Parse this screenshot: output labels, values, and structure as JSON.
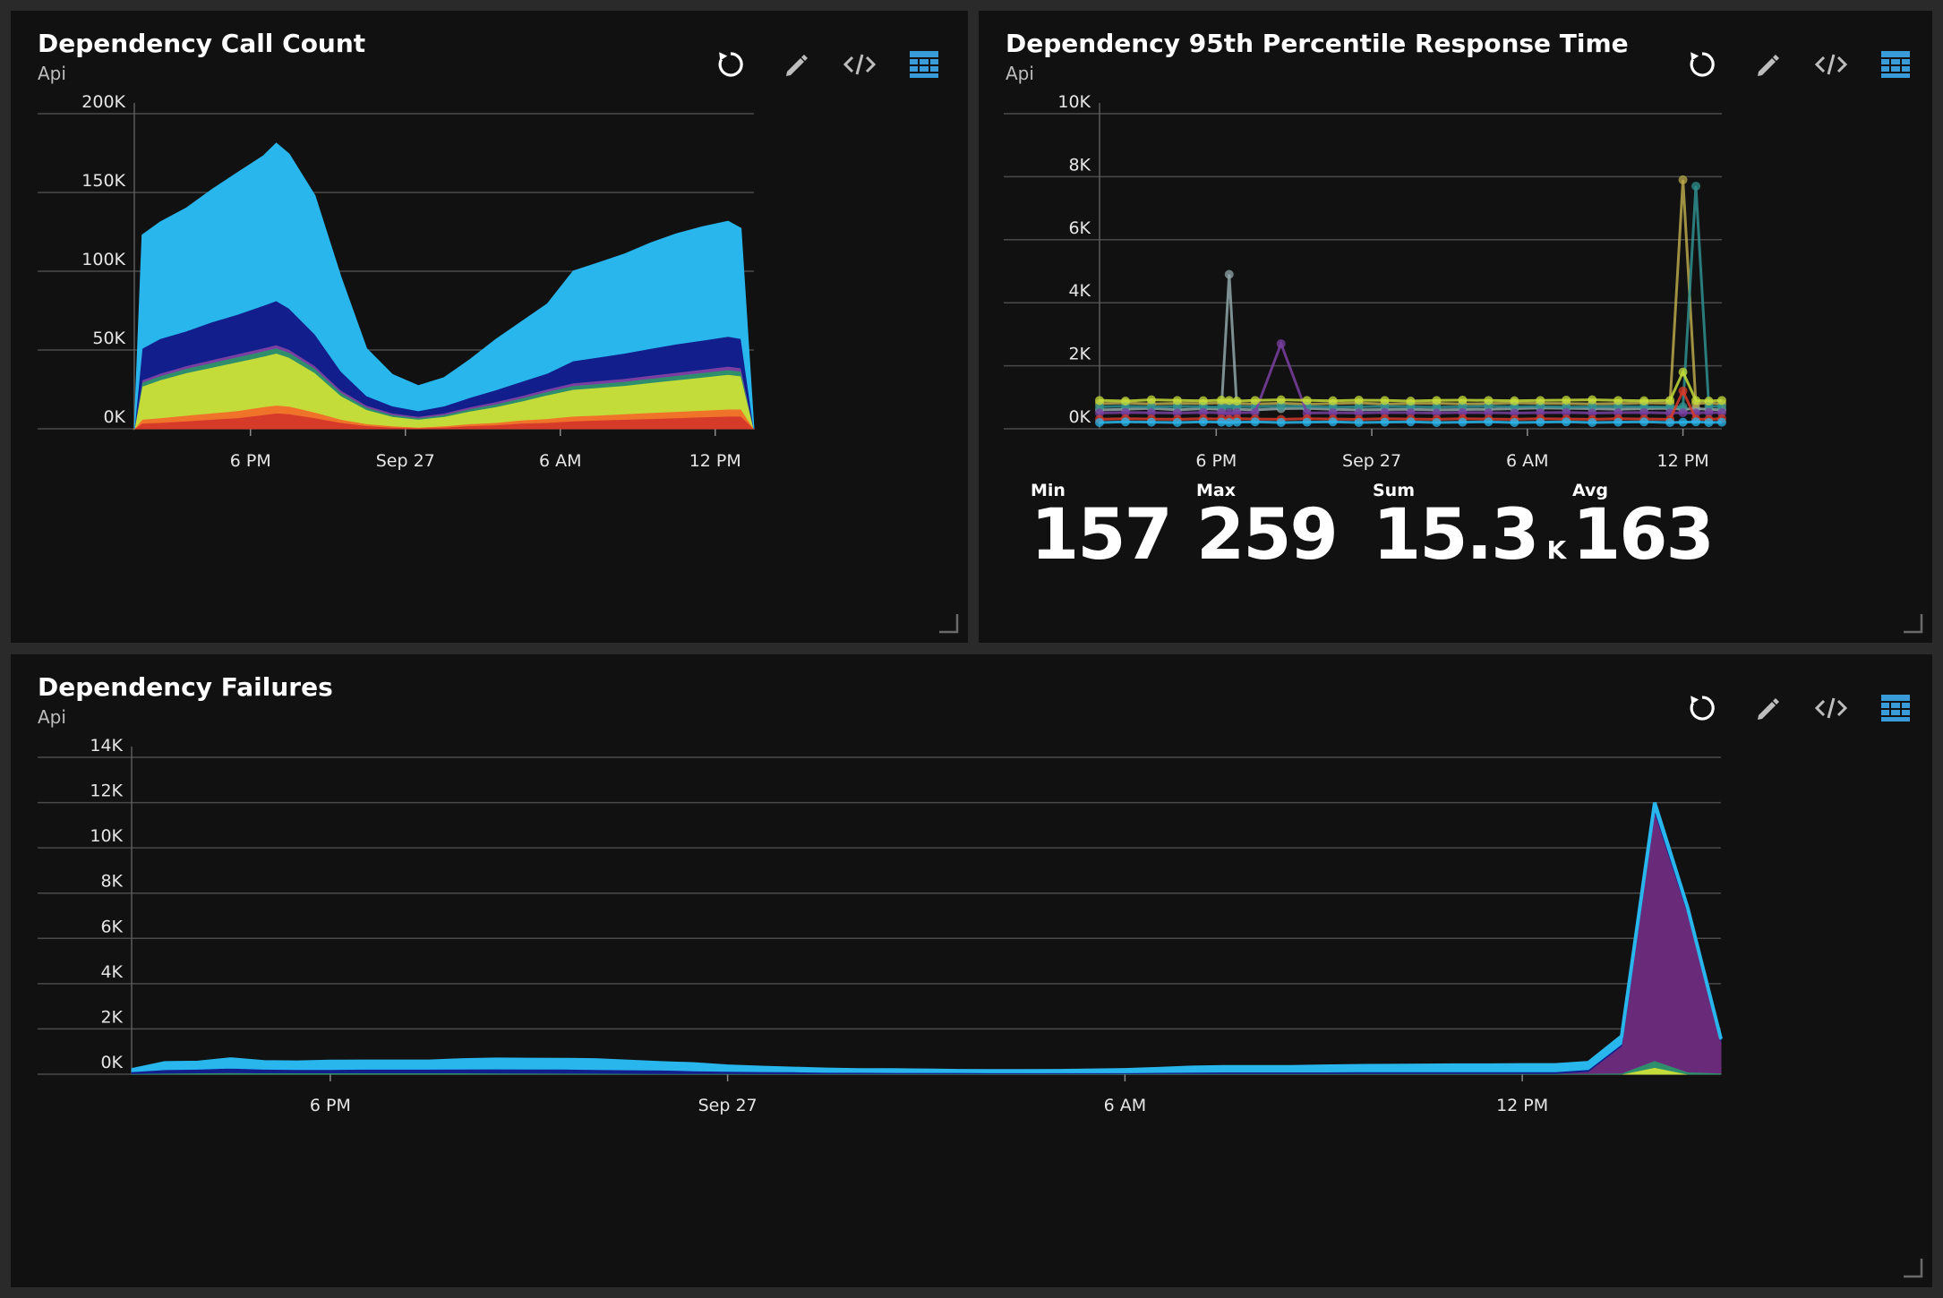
{
  "tiles": {
    "calls": {
      "title": "Dependency Call Count",
      "subtitle": "Api"
    },
    "response": {
      "title": "Dependency 95th Percentile Response Time",
      "subtitle": "Api",
      "stats": {
        "min_label": "Min",
        "min_value": "157",
        "max_label": "Max",
        "max_value": "259",
        "sum_label": "Sum",
        "sum_value": "15.3",
        "sum_unit": "K",
        "avg_label": "Avg",
        "avg_value": "163"
      }
    },
    "failures": {
      "title": "Dependency Failures",
      "subtitle": "Api"
    }
  },
  "icons": [
    "refresh-icon",
    "pencil-icon",
    "code-icon",
    "grid-icon"
  ],
  "colors": {
    "tile_bg": "#111111",
    "page_bg": "#2a2a2b",
    "grid": "#4a4a4a",
    "accent_blue": "#3a9bd9"
  },
  "chart_data": [
    {
      "id": "calls",
      "type": "area",
      "stacked": true,
      "xlim": [
        0,
        24
      ],
      "ylim": [
        0,
        200000
      ],
      "yticks": [
        0,
        50000,
        100000,
        150000,
        200000
      ],
      "ytick_labels": [
        "0K",
        "50K",
        "100K",
        "150K",
        "200K"
      ],
      "xticks": [
        4.5,
        10.5,
        16.5,
        22.5
      ],
      "xtick_labels": [
        "6 PM",
        "Sep 27",
        "6 AM",
        "12 PM"
      ],
      "x": [
        0,
        0.3,
        1,
        2,
        3,
        4,
        5,
        5.5,
        6,
        7,
        8,
        9,
        10,
        11,
        12,
        13,
        14,
        15,
        16,
        17,
        18,
        19,
        20,
        21,
        22,
        23,
        23.5,
        24
      ],
      "series": [
        {
          "color": "#d63b2a",
          "values": [
            0,
            3500,
            4000,
            5000,
            6000,
            7000,
            9000,
            10000,
            9500,
            7000,
            4000,
            2000,
            1000,
            500,
            1000,
            2000,
            2500,
            3500,
            4000,
            5000,
            5500,
            6000,
            6500,
            7000,
            7500,
            8000,
            8000,
            0
          ]
        },
        {
          "color": "#f0732a",
          "values": [
            0,
            2500,
            3000,
            3500,
            4000,
            4500,
            5000,
            5000,
            4800,
            3500,
            2000,
            1200,
            800,
            500,
            800,
            1200,
            1500,
            2000,
            2500,
            3000,
            3200,
            3500,
            3800,
            4000,
            4200,
            4500,
            4500,
            0
          ]
        },
        {
          "color": "#c4dc3a",
          "values": [
            0,
            21000,
            24000,
            27000,
            29000,
            31000,
            32000,
            33000,
            31000,
            25000,
            15000,
            9000,
            6000,
            5000,
            6000,
            8000,
            10000,
            12000,
            15000,
            17000,
            17500,
            18000,
            19000,
            20000,
            21000,
            22000,
            21000,
            0
          ]
        },
        {
          "color": "#2f8f6d",
          "values": [
            0,
            2500,
            2600,
            2800,
            3000,
            3200,
            3300,
            3300,
            3200,
            2800,
            2200,
            1500,
            1200,
            1000,
            1200,
            1500,
            1800,
            2000,
            2200,
            2400,
            2500,
            2600,
            2700,
            2800,
            2900,
            3000,
            3000,
            0
          ]
        },
        {
          "color": "#7a3fa0",
          "values": [
            0,
            1500,
            1600,
            1700,
            1800,
            1900,
            2000,
            2000,
            1900,
            1700,
            1400,
            1200,
            1000,
            900,
            1000,
            1200,
            1400,
            1500,
            1600,
            1700,
            1800,
            1900,
            2000,
            2000,
            2100,
            2200,
            2200,
            0
          ]
        },
        {
          "color": "#111e8c",
          "values": [
            0,
            20000,
            22000,
            22000,
            24000,
            25000,
            27000,
            28000,
            26000,
            20000,
            12000,
            6000,
            4500,
            3500,
            4500,
            6000,
            7500,
            9000,
            10000,
            14000,
            15000,
            16000,
            17000,
            18000,
            18500,
            19000,
            18500,
            0
          ]
        },
        {
          "color": "#29b6ec",
          "values": [
            0,
            72000,
            74000,
            78000,
            84000,
            90000,
            95000,
            100000,
            98000,
            88000,
            60000,
            30000,
            20000,
            16000,
            18000,
            24000,
            32000,
            38000,
            44000,
            57000,
            60000,
            63000,
            67000,
            70000,
            72000,
            73000,
            70000,
            0
          ]
        }
      ]
    },
    {
      "id": "response",
      "type": "line",
      "xlim": [
        0,
        24
      ],
      "ylim": [
        0,
        10000
      ],
      "yticks": [
        0,
        2000,
        4000,
        6000,
        8000,
        10000
      ],
      "ytick_labels": [
        "0K",
        "2K",
        "4K",
        "6K",
        "8K",
        "10K"
      ],
      "xticks": [
        4.5,
        10.5,
        16.5,
        22.5
      ],
      "xtick_labels": [
        "6 PM",
        "Sep 27",
        "6 AM",
        "12 PM"
      ],
      "x": [
        0,
        1,
        2,
        3,
        4,
        4.7,
        5,
        5.3,
        6,
        7,
        8,
        9,
        10,
        11,
        12,
        13,
        14,
        15,
        16,
        17,
        18,
        19,
        20,
        21,
        22,
        22.5,
        23,
        23.5,
        24
      ],
      "series": [
        {
          "color": "#8fa6a8",
          "values": [
            600,
            620,
            650,
            600,
            640,
            620,
            4900,
            620,
            600,
            640,
            650,
            620,
            600,
            610,
            620,
            600,
            610,
            620,
            640,
            660,
            650,
            640,
            620,
            640,
            650,
            620,
            640,
            620,
            600
          ]
        },
        {
          "color": "#b9a84a",
          "values": [
            800,
            820,
            790,
            810,
            800,
            820,
            830,
            800,
            790,
            810,
            780,
            800,
            820,
            790,
            800,
            810,
            790,
            800,
            820,
            810,
            800,
            790,
            800,
            820,
            810,
            7900,
            800,
            820,
            790
          ]
        },
        {
          "color": "#2f8f8f",
          "values": [
            700,
            720,
            690,
            710,
            700,
            690,
            700,
            710,
            700,
            720,
            710,
            690,
            700,
            710,
            700,
            690,
            700,
            720,
            700,
            710,
            690,
            700,
            710,
            700,
            690,
            700,
            7700,
            720,
            700
          ]
        },
        {
          "color": "#7a3fa0",
          "values": [
            500,
            520,
            510,
            500,
            520,
            510,
            500,
            510,
            520,
            2700,
            500,
            510,
            500,
            520,
            510,
            500,
            520,
            510,
            500,
            510,
            520,
            500,
            510,
            520,
            500,
            510,
            500,
            520,
            510
          ]
        },
        {
          "color": "#c4dc3a",
          "values": [
            900,
            880,
            920,
            900,
            890,
            910,
            900,
            880,
            900,
            920,
            900,
            890,
            910,
            900,
            880,
            900,
            910,
            900,
            890,
            900,
            910,
            920,
            900,
            890,
            900,
            1800,
            900,
            880,
            900
          ]
        },
        {
          "color": "#d63b2a",
          "values": [
            300,
            320,
            310,
            300,
            320,
            310,
            300,
            320,
            310,
            300,
            320,
            310,
            300,
            320,
            310,
            300,
            320,
            310,
            300,
            320,
            310,
            300,
            320,
            310,
            300,
            1200,
            310,
            300,
            320
          ]
        },
        {
          "color": "#29b6ec",
          "values": [
            200,
            220,
            210,
            200,
            220,
            210,
            200,
            210,
            220,
            200,
            210,
            220,
            200,
            210,
            220,
            200,
            210,
            220,
            200,
            210,
            220,
            200,
            210,
            220,
            200,
            210,
            220,
            200,
            210
          ]
        }
      ],
      "stats": {
        "min": 157,
        "max": 259,
        "sum": 15300,
        "avg": 163
      }
    },
    {
      "id": "failures",
      "type": "area",
      "stacked": true,
      "xlim": [
        0,
        24
      ],
      "ylim": [
        0,
        14000
      ],
      "yticks": [
        0,
        2000,
        4000,
        6000,
        8000,
        10000,
        12000,
        14000
      ],
      "ytick_labels": [
        "0K",
        "2K",
        "4K",
        "6K",
        "8K",
        "10K",
        "12K",
        "14K"
      ],
      "xticks": [
        3,
        9,
        15,
        21
      ],
      "xtick_labels": [
        "6 PM",
        "Sep 27",
        "6 AM",
        "12 PM"
      ],
      "x": [
        0,
        0.5,
        1,
        1.5,
        2,
        2.5,
        3,
        3.5,
        4,
        4.5,
        5,
        5.5,
        6,
        6.5,
        7,
        7.5,
        8,
        8.5,
        9,
        9.5,
        10,
        10.5,
        11,
        11.5,
        12,
        12.5,
        13,
        13.5,
        14,
        14.5,
        15,
        15.5,
        16,
        16.5,
        17,
        17.5,
        18,
        18.5,
        19,
        19.5,
        20,
        20.5,
        21,
        21.5,
        22,
        22.5,
        23,
        23.5,
        24
      ],
      "series": [
        {
          "color": "#c4dc3a",
          "values": [
            0,
            0,
            0,
            0,
            0,
            0,
            0,
            0,
            0,
            0,
            0,
            0,
            0,
            0,
            0,
            0,
            0,
            0,
            0,
            0,
            0,
            0,
            0,
            0,
            0,
            0,
            0,
            0,
            0,
            0,
            0,
            0,
            0,
            0,
            0,
            0,
            0,
            0,
            0,
            0,
            0,
            0,
            0,
            0,
            0,
            0,
            300,
            0,
            0
          ]
        },
        {
          "color": "#2f8f6d",
          "values": [
            30,
            50,
            60,
            70,
            60,
            60,
            60,
            60,
            60,
            60,
            60,
            55,
            50,
            45,
            40,
            35,
            30,
            30,
            30,
            25,
            25,
            25,
            25,
            25,
            25,
            25,
            25,
            25,
            25,
            25,
            25,
            30,
            30,
            30,
            30,
            30,
            30,
            30,
            30,
            30,
            30,
            30,
            30,
            30,
            30,
            50,
            300,
            100,
            50
          ]
        },
        {
          "color": "#6a2a7a",
          "values": [
            0,
            0,
            0,
            0,
            0,
            0,
            0,
            0,
            0,
            0,
            0,
            0,
            0,
            0,
            0,
            0,
            0,
            0,
            0,
            0,
            0,
            0,
            0,
            0,
            0,
            0,
            0,
            0,
            0,
            0,
            0,
            0,
            0,
            0,
            0,
            0,
            0,
            0,
            0,
            0,
            0,
            0,
            0,
            0,
            100,
            1200,
            11000,
            7000,
            1400
          ]
        },
        {
          "color": "#111e8c",
          "values": [
            80,
            150,
            160,
            200,
            160,
            150,
            150,
            160,
            160,
            160,
            170,
            180,
            180,
            180,
            170,
            160,
            150,
            120,
            100,
            90,
            80,
            60,
            60,
            50,
            50,
            50,
            40,
            40,
            40,
            40,
            40,
            50,
            60,
            70,
            70,
            70,
            70,
            80,
            80,
            80,
            80,
            80,
            80,
            80,
            80,
            80,
            100,
            80,
            60
          ]
        },
        {
          "color": "#29b6ec",
          "values": [
            80,
            300,
            300,
            400,
            320,
            320,
            350,
            350,
            350,
            350,
            400,
            420,
            420,
            420,
            420,
            370,
            320,
            300,
            220,
            180,
            150,
            130,
            100,
            110,
            100,
            80,
            80,
            80,
            90,
            110,
            130,
            160,
            210,
            230,
            230,
            230,
            250,
            260,
            270,
            280,
            290,
            290,
            300,
            300,
            300,
            350,
            300,
            150,
            50
          ]
        }
      ]
    }
  ]
}
